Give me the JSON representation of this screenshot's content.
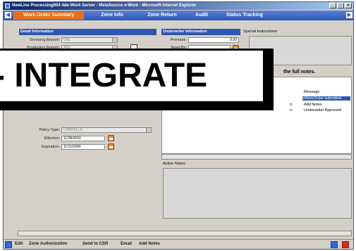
{
  "window": {
    "title": "NewLine Processing004 4de-Work Server - MetaSource e-Work - Microsoft Internet Explorer",
    "controls": [
      "_",
      "□",
      "×"
    ]
  },
  "tabs": [
    {
      "label": "Work Order Summary",
      "active": true
    },
    {
      "label": "Zone Info",
      "active": false
    },
    {
      "label": "Zone Return",
      "active": false
    },
    {
      "label": "Audit",
      "active": false
    },
    {
      "label": "Status Tracking",
      "active": false
    }
  ],
  "detail_info": {
    "heading": "Detail Information",
    "servicing_branch_label": "Servicing Branch:",
    "servicing_branch_value": "OAL",
    "production_branch_label": "Production Branch:",
    "production_branch_value": "ABD",
    "policy_type_label": "Policy Type:",
    "policy_type_value": "UMBRELLA",
    "effective_label": "Effective:",
    "effective_value": "11/28/2003",
    "expiration_label": "Expiration:",
    "expiration_value": "11/11/2004"
  },
  "underwriter_info": {
    "heading": "Underwriter Information",
    "premium_label": "Premium:",
    "premium_value": "0.00",
    "need_by_label": "Need By:",
    "need_by_value": ""
  },
  "special_instructions_label": "Special Instructions:",
  "notes_hint": "the full notes.",
  "messages": {
    "header": "Message",
    "rows": [
      {
        "prefix": "",
        "text": "eWorkOrder submitted",
        "selected": true
      },
      {
        "prefix": "n:",
        "text": "Add Notes",
        "selected": false
      },
      {
        "prefix": "n:",
        "text": "Underwriter Approved",
        "selected": false
      }
    ]
  },
  "action_notes_label": "Action Notes:",
  "bottom_actions": [
    "Edit",
    "Zone Authorization",
    "Send to CSR",
    "Email",
    "Add Notes"
  ],
  "overlay_text": "- INTEGRATE"
}
